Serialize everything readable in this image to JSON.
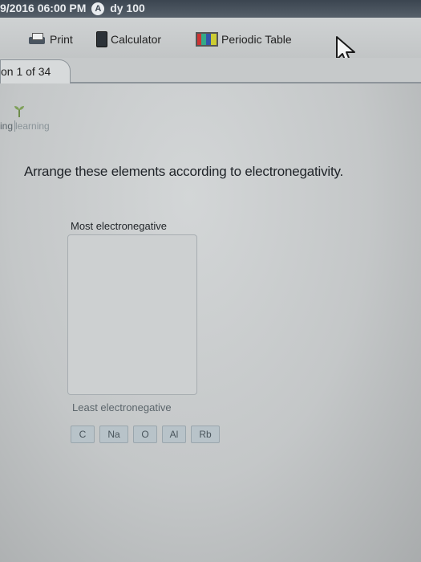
{
  "header": {
    "text_left": "9/2016 06:00 PM",
    "badge": "A",
    "text_right": "dy 100"
  },
  "toolbar": {
    "print_label": "Print",
    "calculator_label": "Calculator",
    "periodic_table_label": "Periodic Table"
  },
  "tabs": {
    "question_tab": "on 1 of 34"
  },
  "logo": {
    "text_left": "ing",
    "text_right": "learning"
  },
  "question": {
    "prompt": "Arrange these elements according to electronegativity.",
    "most_label": "Most electronegative",
    "least_label": "Least electronegative",
    "elements": [
      "C",
      "Na",
      "O",
      "Al",
      "Rb"
    ]
  },
  "colors": {
    "header_bg": "#3b4550",
    "chip_bg": "#b8c3c9",
    "page_bg": "#c4c7c8"
  }
}
